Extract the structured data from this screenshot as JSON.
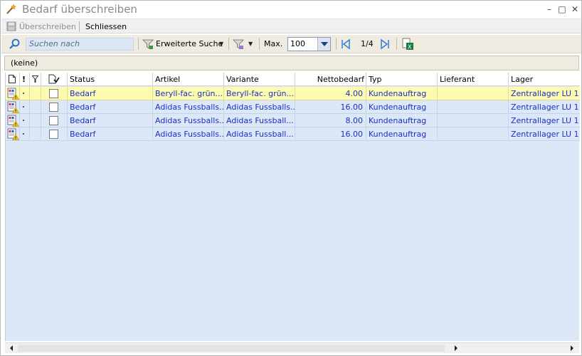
{
  "window": {
    "title": "Bedarf überschreiben",
    "controls": {
      "minimize": "–",
      "maximize": "□",
      "close": "✕"
    }
  },
  "toolbar": {
    "save_label": "Überschreiben",
    "close_label": "Schliessen"
  },
  "search": {
    "placeholder": "Suchen nach",
    "advanced_label": "Erweiterte Suche",
    "max_label": "Max.",
    "max_value": "100",
    "page_label": "1/4"
  },
  "grouping": {
    "label": "(keine)"
  },
  "grid": {
    "columns": {
      "status": "Status",
      "artikel": "Artikel",
      "variante": "Variante",
      "nettobedarf": "Nettobedarf",
      "typ": "Typ",
      "lieferant": "Lieferant",
      "lager": "Lager"
    },
    "rows": [
      {
        "status": "Bedarf",
        "artikel": "Beryll-fac. grün...",
        "variante": "Beryll-fac. grün...",
        "nettobedarf": "4.00",
        "typ": "Kundenauftrag",
        "lieferant": "",
        "lager": "Zentrallager LU 1"
      },
      {
        "status": "Bedarf",
        "artikel": "Adidas Fussballs...",
        "variante": "Adidas Fussballs...",
        "nettobedarf": "16.00",
        "typ": "Kundenauftrag",
        "lieferant": "",
        "lager": "Zentrallager LU 1"
      },
      {
        "status": "Bedarf",
        "artikel": "Adidas Fussballs...",
        "variante": "Adidas Fussball...",
        "nettobedarf": "8.00",
        "typ": "Kundenauftrag",
        "lieferant": "",
        "lager": "Zentrallager LU 1"
      },
      {
        "status": "Bedarf",
        "artikel": "Adidas Fussballs...",
        "variante": "Adidas Fussball...",
        "nettobedarf": "16.00",
        "typ": "Kundenauftrag",
        "lieferant": "",
        "lager": "Zentrallager LU 1"
      }
    ]
  },
  "colors": {
    "selected_row": "#fbfbb2",
    "grid_background": "#dce8f7",
    "row_text": "#1a2fc8",
    "toolbar_background": "#f0ebe1"
  },
  "icons": [
    "magic-wand-icon",
    "save-icon",
    "search-icon",
    "filter-add-icon",
    "filter-clear-icon",
    "first-page-icon",
    "next-page-icon",
    "excel-export-icon",
    "new-document-icon",
    "warning-document-icon"
  ]
}
